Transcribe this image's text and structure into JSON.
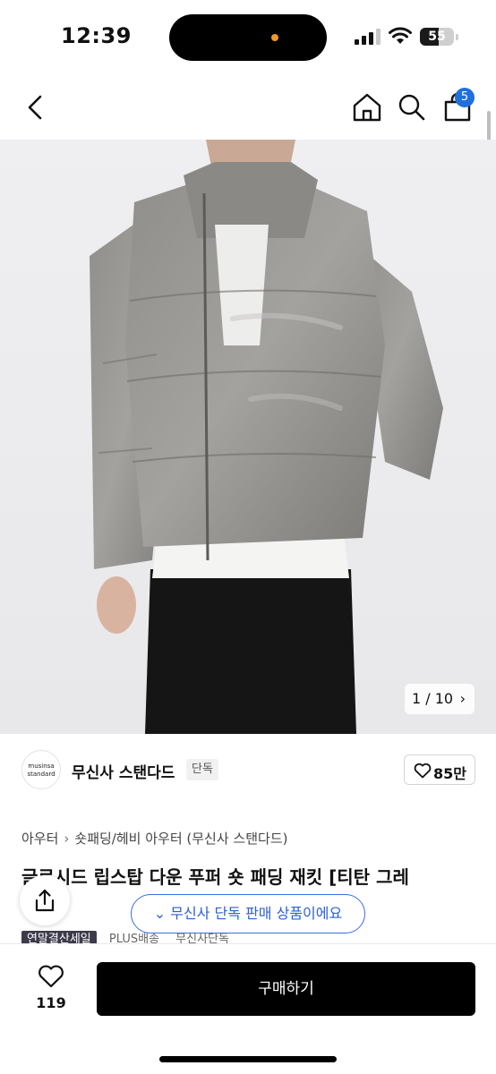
{
  "status_bar": {
    "time": "12:39",
    "battery": "55",
    "battery_level": 0.55
  },
  "nav": {
    "cart_badge": "5"
  },
  "gallery": {
    "counter": "1 / 10",
    "chevron": "›"
  },
  "brand": {
    "logo_line1": "musinsa",
    "logo_line2": "standard",
    "name": "무신사 스탠다드",
    "tag": "단독",
    "like_count": "85만"
  },
  "breadcrumb": {
    "items": [
      "아우터",
      "숏패딩/헤비 아우터 (무신사 스탠다드)"
    ],
    "separator": "›"
  },
  "product": {
    "title": "글로시드 립스탑 다운 푸퍼 숏 패딩 재킷 [티탄 그레",
    "tags": [
      "연말결산세일",
      "PLUS배송",
      "무신사단독"
    ]
  },
  "exclusive_pill": {
    "chevron": "⌄",
    "label": "무신사 단독 판매 상품이에요"
  },
  "bottom_bar": {
    "wish_count": "119",
    "buy_label": "구매하기"
  },
  "colors": {
    "accent_blue": "#2c5fd6",
    "badge_blue": "#1f6fdc",
    "buy_button": "#000000",
    "tag_dark": "#3d3a4a"
  }
}
